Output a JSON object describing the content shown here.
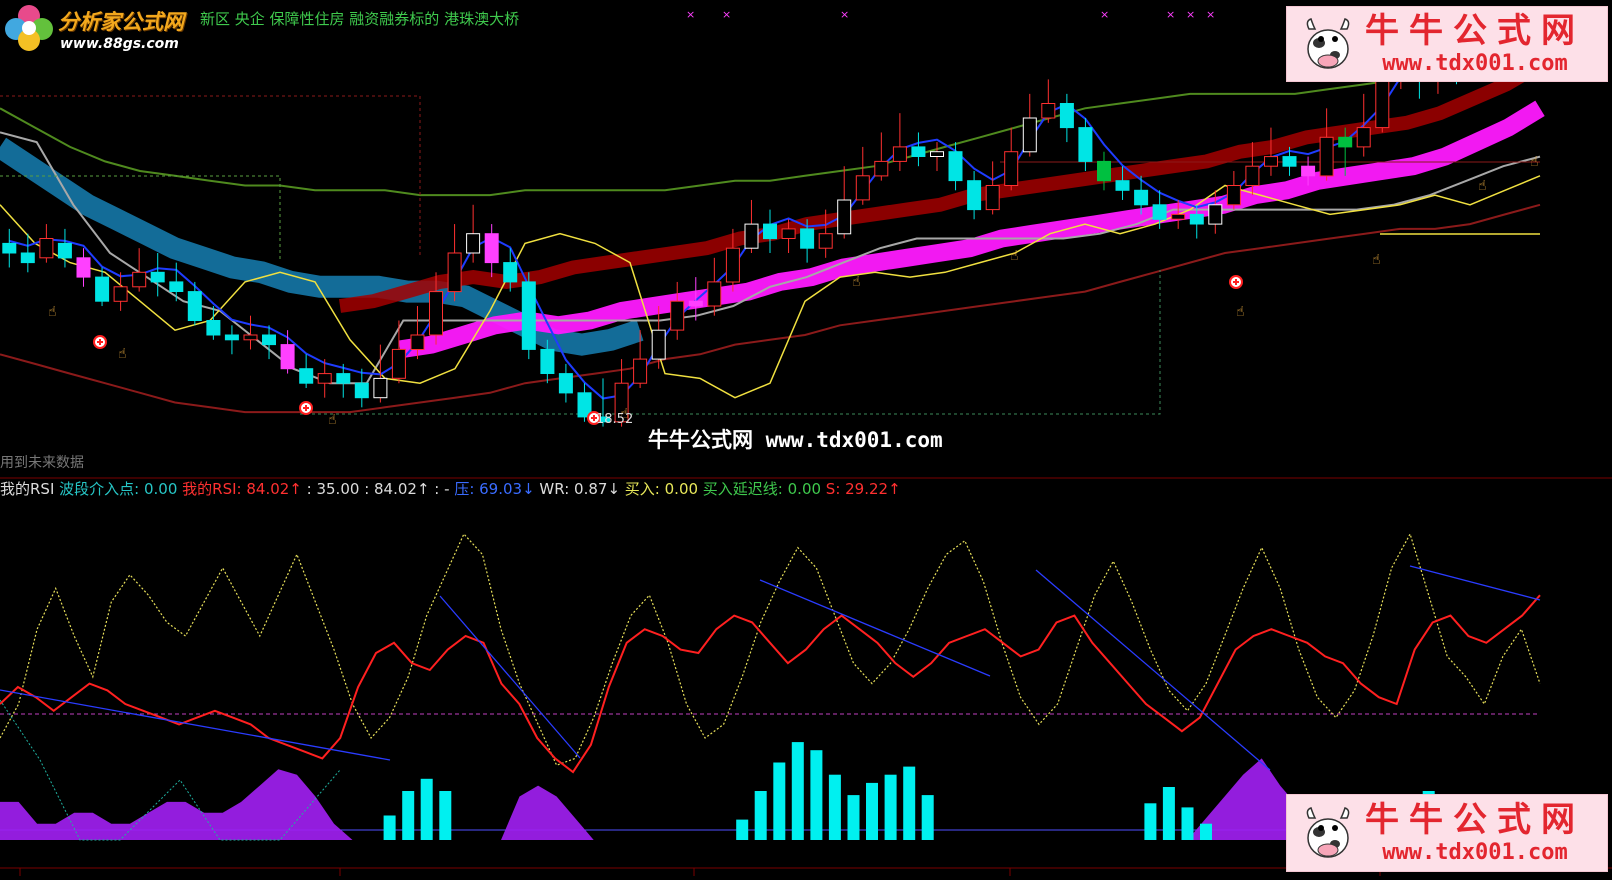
{
  "app": {
    "logo_brand": "分析家公式网",
    "logo_url": "www.88gs.com",
    "top_text": "新区 央企 保障性住房 融资融券标的 港珠澳大桥",
    "future_text": "用到未来数据",
    "center_watermark": "牛牛公式网 www.tdx001.com",
    "watermark_cn": "牛牛公式网",
    "watermark_url": "www.tdx001.com",
    "price_label": "18.52",
    "colors": {
      "background": "#000000",
      "red": "#ff3030",
      "cyan": "#00ffff",
      "magenta": "#ff00ff",
      "purple": "#a020f0"
    }
  },
  "indicator_bar": {
    "name": "我的RSI",
    "items": [
      {
        "label": "波段介入点:",
        "value": "0.00",
        "label_color": "cyan",
        "value_color": "cyan"
      },
      {
        "label": "我的RSI:",
        "value": "84.02↑",
        "label_color": "red",
        "value_color": "red"
      },
      {
        "label": ":",
        "value": "35.00",
        "label_color": "white",
        "value_color": "white"
      },
      {
        "label": ":",
        "value": "84.02↑",
        "label_color": "white",
        "value_color": "white"
      },
      {
        "label": ": -",
        "value": "",
        "label_color": "white",
        "value_color": "white"
      },
      {
        "label": "压:",
        "value": "69.03↓",
        "label_color": "blue",
        "value_color": "blue"
      },
      {
        "label": "WR:",
        "value": "0.87↓",
        "label_color": "white",
        "value_color": "white"
      },
      {
        "label": "买入:",
        "value": "0.00",
        "label_color": "yel",
        "value_color": "yel"
      },
      {
        "label": "买入延迟线:",
        "value": "0.00",
        "label_color": "green",
        "value_color": "green"
      },
      {
        "label": "S:",
        "value": "29.22↑",
        "label_color": "red",
        "value_color": "red"
      }
    ]
  },
  "chart_data": [
    {
      "type": "candlestick",
      "panel": "price",
      "ylim": [
        17.5,
        26.5
      ],
      "candles": [
        [
          22.2,
          22.0,
          22.5,
          21.7
        ],
        [
          22.0,
          21.8,
          22.4,
          21.6
        ],
        [
          21.9,
          22.3,
          22.6,
          21.8
        ],
        [
          22.2,
          21.9,
          22.5,
          21.7
        ],
        [
          21.9,
          21.5,
          22.1,
          21.3
        ],
        [
          21.5,
          21.0,
          21.7,
          20.9
        ],
        [
          21.0,
          21.3,
          21.6,
          20.8
        ],
        [
          21.3,
          21.6,
          22.1,
          21.2
        ],
        [
          21.6,
          21.4,
          22.0,
          21.1
        ],
        [
          21.4,
          21.2,
          21.8,
          21.0
        ],
        [
          21.2,
          20.6,
          21.4,
          20.5
        ],
        [
          20.6,
          20.3,
          20.9,
          20.2
        ],
        [
          20.3,
          20.2,
          20.5,
          19.9
        ],
        [
          20.2,
          20.3,
          20.7,
          20.0
        ],
        [
          20.3,
          20.1,
          20.5,
          19.8
        ],
        [
          20.1,
          19.6,
          20.4,
          19.5
        ],
        [
          19.6,
          19.3,
          19.9,
          19.2
        ],
        [
          19.3,
          19.5,
          19.8,
          19.0
        ],
        [
          19.5,
          19.3,
          19.7,
          19.0
        ],
        [
          19.3,
          19.0,
          19.6,
          18.8
        ],
        [
          19.0,
          19.4,
          20.1,
          18.9
        ],
        [
          19.4,
          20.0,
          20.6,
          19.3
        ],
        [
          20.0,
          20.3,
          20.9,
          19.8
        ],
        [
          20.3,
          21.2,
          21.6,
          20.1
        ],
        [
          21.2,
          22.0,
          22.6,
          21.0
        ],
        [
          22.0,
          22.4,
          23.0,
          21.8
        ],
        [
          22.4,
          21.8,
          22.6,
          21.5
        ],
        [
          21.8,
          21.4,
          22.1,
          21.2
        ],
        [
          21.4,
          20.0,
          21.6,
          19.8
        ],
        [
          20.0,
          19.5,
          20.2,
          19.3
        ],
        [
          19.5,
          19.1,
          19.7,
          18.9
        ],
        [
          19.1,
          18.6,
          19.3,
          18.5
        ],
        [
          18.6,
          18.5,
          19.4,
          18.4
        ],
        [
          18.5,
          19.3,
          19.8,
          18.4
        ],
        [
          19.3,
          19.8,
          20.4,
          19.2
        ],
        [
          19.8,
          20.4,
          20.9,
          19.6
        ],
        [
          20.4,
          21.0,
          21.4,
          20.2
        ],
        [
          21.0,
          20.9,
          21.5,
          20.6
        ],
        [
          20.9,
          21.4,
          21.9,
          20.7
        ],
        [
          21.4,
          22.1,
          22.5,
          21.2
        ],
        [
          22.1,
          22.6,
          23.1,
          22.0
        ],
        [
          22.6,
          22.3,
          22.9,
          22.0
        ],
        [
          22.3,
          22.5,
          22.7,
          22.0
        ],
        [
          22.5,
          22.1,
          22.7,
          21.8
        ],
        [
          22.1,
          22.4,
          22.9,
          21.9
        ],
        [
          22.4,
          23.1,
          23.8,
          22.3
        ],
        [
          23.1,
          23.6,
          24.2,
          23.0
        ],
        [
          23.6,
          23.9,
          24.5,
          23.5
        ],
        [
          23.9,
          24.2,
          24.9,
          23.7
        ],
        [
          24.2,
          24.0,
          24.5,
          23.8
        ],
        [
          24.0,
          24.1,
          24.3,
          23.7
        ],
        [
          24.1,
          23.5,
          24.3,
          23.3
        ],
        [
          23.5,
          22.9,
          23.7,
          22.7
        ],
        [
          22.9,
          23.4,
          23.9,
          22.8
        ],
        [
          23.4,
          24.1,
          24.6,
          23.3
        ],
        [
          24.1,
          24.8,
          25.3,
          24.0
        ],
        [
          24.8,
          25.1,
          25.6,
          24.7
        ],
        [
          25.1,
          24.6,
          25.3,
          24.3
        ],
        [
          24.6,
          23.9,
          24.8,
          23.7
        ],
        [
          23.9,
          23.5,
          24.1,
          23.3
        ],
        [
          23.5,
          23.3,
          23.8,
          23.1
        ],
        [
          23.3,
          23.0,
          23.6,
          22.8
        ],
        [
          23.0,
          22.7,
          23.3,
          22.5
        ],
        [
          22.7,
          22.8,
          23.1,
          22.5
        ],
        [
          22.8,
          22.6,
          23.0,
          22.3
        ],
        [
          22.6,
          23.0,
          23.3,
          22.4
        ],
        [
          23.0,
          23.4,
          23.7,
          22.9
        ],
        [
          23.4,
          23.8,
          24.3,
          23.2
        ],
        [
          23.8,
          24.0,
          24.6,
          23.6
        ],
        [
          24.0,
          23.8,
          24.2,
          23.6
        ],
        [
          23.8,
          23.6,
          24.0,
          23.4
        ],
        [
          23.6,
          24.4,
          25.0,
          23.5
        ],
        [
          24.4,
          24.2,
          24.6,
          23.6
        ],
        [
          24.2,
          24.6,
          25.3,
          24.0
        ],
        [
          24.6,
          25.6,
          26.3,
          24.5
        ],
        [
          25.6,
          26.0,
          26.8,
          25.4
        ],
        [
          26.0,
          25.6,
          26.4,
          25.2
        ],
        [
          25.6,
          26.0,
          26.5,
          25.3
        ],
        [
          26.0,
          25.8,
          26.3,
          25.5
        ],
        [
          25.8,
          26.0,
          26.4,
          25.7
        ],
        [
          26.0,
          26.1,
          26.6,
          25.9
        ],
        [
          26.1,
          26.4,
          26.9,
          26.0
        ],
        [
          26.4,
          26.3,
          26.8,
          26.1
        ]
      ],
      "cyan_ribbon_top": [
        24.2,
        23.8,
        23.4,
        23.0,
        22.7,
        22.4,
        22.1,
        21.9,
        21.7,
        21.6,
        21.4,
        21.3,
        21.3,
        21.3,
        21.2,
        21.2,
        21.1,
        20.8,
        20.5,
        20.2,
        20.1,
        20.2,
        20.4
      ],
      "magenta_ribbon": [
        20.0,
        20.1,
        20.3,
        20.5,
        20.6,
        20.5,
        20.6,
        20.8,
        20.9,
        21.0,
        21.1,
        21.2,
        21.4,
        21.5,
        21.7,
        21.8,
        21.9,
        22.0,
        22.1,
        22.3,
        22.4,
        22.5,
        22.6,
        22.7,
        22.8,
        22.9,
        23.0,
        23.2,
        23.3,
        23.5,
        23.6,
        23.7,
        23.8,
        24.0,
        24.3,
        24.6,
        25.0
      ],
      "green_band": [
        25.0,
        24.6,
        24.2,
        23.9,
        23.7,
        23.6,
        23.5,
        23.4,
        23.4,
        23.3,
        23.3,
        23.3,
        23.2,
        23.2,
        23.2,
        23.3,
        23.3,
        23.3,
        23.3,
        23.3,
        23.4,
        23.5,
        23.5,
        23.6,
        23.7,
        23.8,
        24.0,
        24.2,
        24.4,
        24.6,
        24.8,
        25.0,
        25.1,
        25.2,
        25.3,
        25.3,
        25.3,
        25.3,
        25.4,
        25.5,
        25.6,
        25.8,
        26.0,
        26.3,
        26.6
      ],
      "red_band": [
        19.9,
        19.7,
        19.5,
        19.3,
        19.1,
        18.9,
        18.8,
        18.7,
        18.7,
        18.7,
        18.7,
        18.8,
        18.9,
        19.0,
        19.1,
        19.3,
        19.4,
        19.5,
        19.6,
        19.8,
        19.9,
        20.1,
        20.2,
        20.3,
        20.5,
        20.6,
        20.7,
        20.8,
        20.9,
        21.0,
        21.1,
        21.2,
        21.4,
        21.6,
        21.8,
        22.0,
        22.1,
        22.2,
        22.3,
        22.4,
        22.5,
        22.5,
        22.6,
        22.8,
        23.0
      ]
    },
    {
      "type": "line",
      "panel": "indicator",
      "ylim": [
        0,
        100
      ],
      "series": [
        {
          "values": [
            40,
            45,
            42,
            38,
            42,
            46,
            44,
            40,
            38,
            36,
            34,
            36,
            38,
            36,
            34,
            30,
            28,
            26,
            24,
            30,
            45,
            55,
            58,
            52,
            50,
            56,
            60,
            58,
            46,
            40,
            30,
            24,
            20,
            28,
            45,
            58,
            62,
            60,
            56,
            55,
            62,
            66,
            64,
            58,
            52,
            56,
            62,
            66,
            62,
            58,
            52,
            48,
            52,
            58,
            60,
            62,
            58,
            54,
            56,
            64,
            66,
            58,
            52,
            46,
            40,
            36,
            32,
            36,
            46,
            56,
            60,
            62,
            60,
            58,
            54,
            52,
            46,
            42,
            40,
            56,
            64,
            66,
            60,
            58,
            62,
            66,
            72
          ]
        },
        {
          "values": [
            30,
            40,
            62,
            74,
            60,
            48,
            70,
            78,
            72,
            64,
            60,
            70,
            80,
            70,
            60,
            72,
            84,
            70,
            56,
            40,
            30,
            36,
            48,
            66,
            78,
            90,
            84,
            62,
            46,
            34,
            22,
            24,
            36,
            52,
            66,
            72,
            58,
            40,
            30,
            34,
            48,
            64,
            76,
            86,
            80,
            66,
            52,
            46,
            52,
            62,
            74,
            84,
            88,
            76,
            58,
            42,
            34,
            40,
            56,
            72,
            82,
            70,
            56,
            44,
            38,
            46,
            60,
            74,
            86,
            74,
            56,
            42,
            36,
            44,
            60,
            80,
            90,
            72,
            54,
            48,
            40,
            54,
            62,
            46
          ]
        },
        {
          "values": [
            0,
            0,
            0,
            0,
            0,
            0,
            0,
            0,
            0,
            0,
            0,
            0,
            0,
            0,
            0,
            0,
            0,
            0,
            0,
            0,
            0,
            12,
            24,
            30,
            24,
            0,
            0,
            0,
            0,
            0,
            0,
            0,
            0,
            0,
            0,
            0,
            0,
            0,
            0,
            0,
            10,
            24,
            38,
            48,
            44,
            32,
            22,
            28,
            32,
            36,
            22,
            0,
            0,
            0,
            0,
            0,
            0,
            0,
            0,
            0,
            0,
            0,
            18,
            26,
            16,
            8,
            0,
            0,
            0,
            0,
            0,
            0,
            0,
            0,
            0,
            0,
            0,
            24,
            18,
            14,
            10,
            8,
            6,
            22
          ]
        },
        {
          "values": [
            14,
            14,
            6,
            6,
            10,
            10,
            6,
            6,
            10,
            14,
            14,
            10,
            10,
            14,
            20,
            26,
            24,
            16,
            6,
            0,
            0,
            0,
            0,
            0,
            0,
            0,
            0,
            0,
            16,
            20,
            16,
            8,
            0,
            0,
            0,
            0,
            0,
            0,
            0,
            0,
            0,
            0,
            0,
            0,
            0,
            0,
            0,
            0,
            0,
            0,
            0,
            0,
            0,
            0,
            0,
            0,
            0,
            0,
            0,
            0,
            0,
            0,
            0,
            0,
            0,
            8,
            16,
            24,
            30,
            20,
            12,
            0,
            0,
            0,
            0,
            0,
            0,
            0,
            0,
            0,
            0,
            0,
            0,
            0
          ]
        }
      ]
    }
  ]
}
